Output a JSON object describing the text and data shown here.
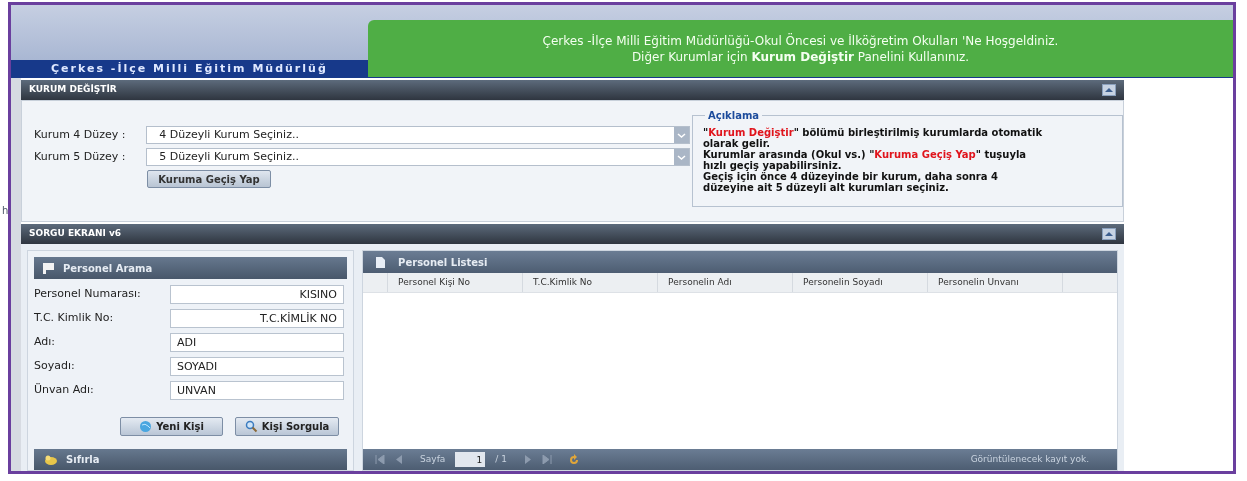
{
  "edge_text": "h",
  "header": {
    "title": "Çerkes -İlçe Milli Eğitim Müdürlüğ"
  },
  "welcome_banner": {
    "line1": "Çerkes -İlçe Milli Eğitim Müdürlüğü-Okul Öncesi ve İlköğretim Okulları 'Ne Hoşgeldiniz.",
    "line2": "Diğer Kurumlar için **Kurum Değiştir** Panelini Kullanınız."
  },
  "kurum_panel": {
    "title": "KURUM DEĞİŞTİR",
    "selects": [
      {
        "label": "Kurum 4 Düzey :",
        "value": "4 Düzeyli Kurum Seçiniz.."
      },
      {
        "label": "Kurum 5 Düzey :",
        "value": "5 Düzeyli Kurum Seçiniz.."
      }
    ],
    "button": "Kuruma Geçiş Yap",
    "info": {
      "legend": "Açıklama",
      "lines": [
        [
          {
            "text": "\"",
            "highlight": false
          },
          {
            "text": "Kurum Değiştir",
            "highlight": true
          },
          {
            "text": "\" bölümü birleştirilmiş kurumlarda otomatik olarak gelir.",
            "highlight": false
          }
        ],
        [
          {
            "text": "Kurumlar arasında (Okul vs.) \"",
            "highlight": false
          },
          {
            "text": "Kuruma Geçiş Yap",
            "highlight": true
          },
          {
            "text": "\" tuşuyla hızlı geçiş yapabilirsiniz.",
            "highlight": false
          }
        ],
        [
          {
            "text": "Geçiş için önce 4 düzeyinde bir kurum, daha sonra 4 düzeyine ait 5 düzeyli alt kurumları seçiniz.",
            "highlight": false
          }
        ]
      ]
    }
  },
  "sorgu_panel": {
    "title": "SORGU EKRANI v6",
    "search": {
      "title": "Personel Arama",
      "fields": [
        {
          "label": "Personel Numarası:",
          "value": "KISINO",
          "right_aligned": true
        },
        {
          "label": "T.C. Kimlik No:",
          "value": "T.C.KİMLİK NO",
          "right_aligned": true
        },
        {
          "label": "Adı:",
          "value": "ADI",
          "right_aligned": false
        },
        {
          "label": "Soyadı:",
          "value": "SOYADI",
          "right_aligned": false
        },
        {
          "label": "Ünvan Adı:",
          "value": "UNVAN",
          "right_aligned": false
        }
      ],
      "buttons": [
        "Yeni Kişi",
        "Kişi Sorgula"
      ],
      "reset": "Sıfırla"
    },
    "list": {
      "title": "Personel Listesi",
      "columns": [
        "Personel Kişi No",
        "T.C.Kimlik No",
        "Personelin Adı",
        "Personelin Soyadı",
        "Personelin Unvanı"
      ],
      "pager": {
        "page_label": "Sayfa",
        "page": "1",
        "total": "/ 1",
        "status": "Görüntülenecek kayıt yok."
      }
    }
  }
}
